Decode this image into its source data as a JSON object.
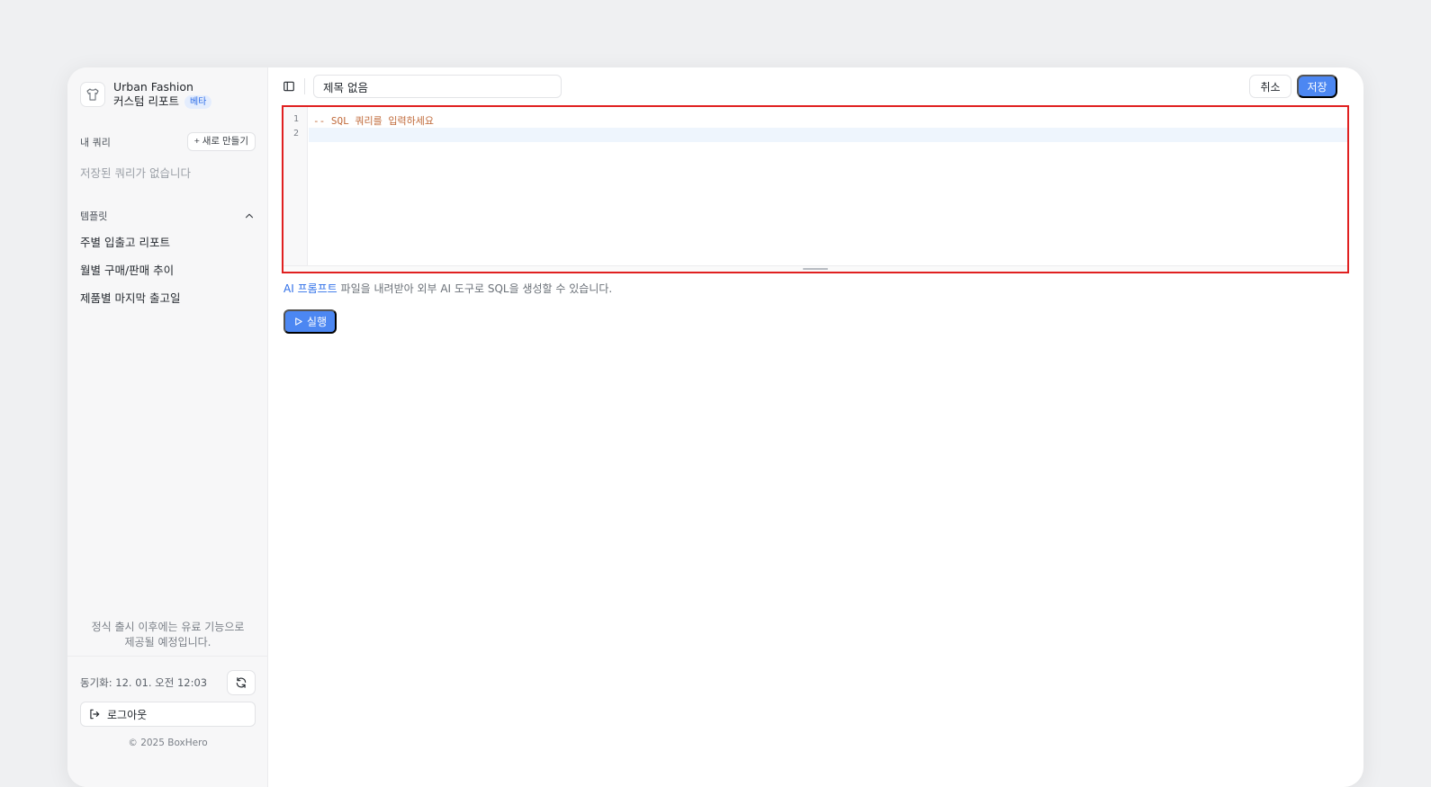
{
  "sidebar": {
    "brand_name": "Urban Fashion",
    "brand_subtitle": "커스텀 리포트",
    "beta_label": "베타",
    "my_queries": {
      "label": "내 쿼리",
      "new_button": "+ 새로 만들기",
      "empty_text": "저장된 쿼리가 없습니다"
    },
    "templates": {
      "label": "템플릿",
      "items": [
        "주별 입출고 리포트",
        "월별 구매/판매 추이",
        "제품별 마지막 출고일"
      ]
    },
    "promo_line1": "정식 출시 이후에는 유료 기능으로",
    "promo_line2": "제공될 예정입니다.",
    "sync_text": "동기화: 12. 01. 오전 12:03",
    "logout_label": "로그아웃",
    "copyright": "© 2025 BoxHero"
  },
  "toolbar": {
    "title_value": "제목 없음",
    "cancel_label": "취소",
    "save_label": "저장"
  },
  "editor": {
    "line_numbers": [
      "1",
      "2"
    ],
    "lines": [
      "-- SQL 쿼리를 입력하세요",
      ""
    ]
  },
  "hint": {
    "link_text": "AI 프롬프트",
    "rest_text": " 파일을 내려받아 외부 AI 도구로 SQL을 생성할 수 있습니다."
  },
  "run_label": "실행",
  "colors": {
    "accent": "#4c87f2",
    "comment": "#c06a3a",
    "highlight_border": "#e02020"
  }
}
